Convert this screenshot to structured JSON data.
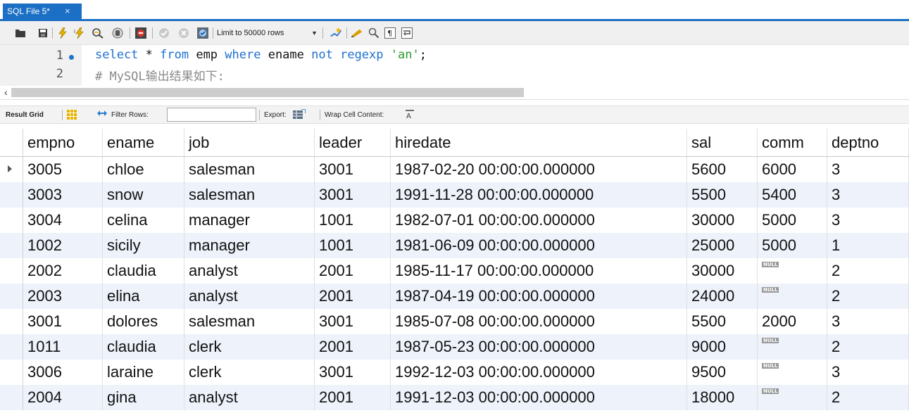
{
  "tab": {
    "title": "SQL File 5*",
    "close": "×"
  },
  "toolbar": {
    "limit_label": "Limit to 50000 rows",
    "icons": [
      "open-folder-icon",
      "save-icon",
      "execute-icon",
      "execute-current-icon",
      "explain-icon",
      "stop-icon",
      "toggle-error-icon",
      "commit-icon",
      "rollback-icon",
      "autocommit-icon",
      "beautify-icon",
      "find-icon",
      "invisible-chars-icon",
      "wrap-icon"
    ]
  },
  "editor": {
    "lines": [
      {
        "num": "1",
        "sql": {
          "kw1": "select",
          "t1": " * ",
          "kw2": "from",
          "t2": " emp ",
          "kw3": "where",
          "t3": " ename ",
          "kw4": "not",
          "t4": " ",
          "kw5": "regexp",
          "t5": " ",
          "str": "'an'",
          "t6": ";"
        }
      },
      {
        "num": "2",
        "comment": "# MySQL输出结果如下:"
      }
    ]
  },
  "result_toolbar": {
    "result_grid": "Result Grid",
    "filter_rows": "Filter Rows:",
    "export": "Export:",
    "wrap": "Wrap Cell Content:"
  },
  "grid": {
    "columns": [
      "empno",
      "ename",
      "job",
      "leader",
      "hiredate",
      "sal",
      "comm",
      "deptno"
    ],
    "rows": [
      [
        "3005",
        "chloe",
        "salesman",
        "3001",
        "1987-02-20 00:00:00.000000",
        "5600",
        "6000",
        "3"
      ],
      [
        "3003",
        "snow",
        "salesman",
        "3001",
        "1991-11-28 00:00:00.000000",
        "5500",
        "5400",
        "3"
      ],
      [
        "3004",
        "celina",
        "manager",
        "1001",
        "1982-07-01 00:00:00.000000",
        "30000",
        "5000",
        "3"
      ],
      [
        "1002",
        "sicily",
        "manager",
        "1001",
        "1981-06-09 00:00:00.000000",
        "25000",
        "5000",
        "1"
      ],
      [
        "2002",
        "claudia",
        "analyst",
        "2001",
        "1985-11-17 00:00:00.000000",
        "30000",
        "NULL",
        "2"
      ],
      [
        "2003",
        "elina",
        "analyst",
        "2001",
        "1987-04-19 00:00:00.000000",
        "24000",
        "NULL",
        "2"
      ],
      [
        "3001",
        "dolores",
        "salesman",
        "3001",
        "1985-07-08 00:00:00.000000",
        "5500",
        "2000",
        "3"
      ],
      [
        "1011",
        "claudia",
        "clerk",
        "2001",
        "1987-05-23 00:00:00.000000",
        "9000",
        "NULL",
        "2"
      ],
      [
        "3006",
        "laraine",
        "clerk",
        "3001",
        "1992-12-03 00:00:00.000000",
        "9500",
        "NULL",
        "3"
      ],
      [
        "2004",
        "gina",
        "analyst",
        "2001",
        "1991-12-03 00:00:00.000000",
        "18000",
        "NULL",
        "2"
      ]
    ]
  },
  "colors": {
    "accent": "#1b6fc4",
    "keyword": "#1d6fd0",
    "string": "#2c9a2c",
    "comment": "#8a8a8a",
    "row_alt": "#eef2fb"
  }
}
